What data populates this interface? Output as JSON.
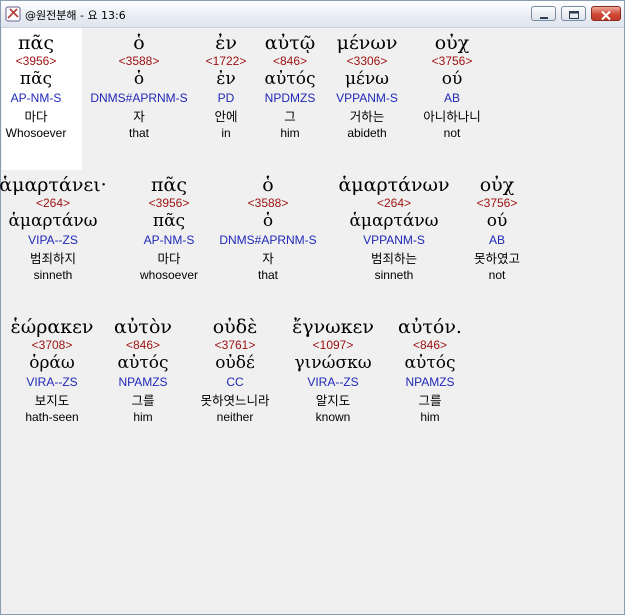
{
  "window": {
    "title": "@원전분해 - 요 13:6",
    "buttons": [
      "minimize",
      "maximize",
      "close"
    ],
    "close_color": "#c9402d"
  },
  "colors": {
    "strong": "#9c1010",
    "parse": "#1f28b8",
    "highlight": "#ffffff",
    "background": "#f0f0f0"
  },
  "rows": [
    {
      "words": [
        {
          "greek": "πᾶς",
          "strong": "<3956>",
          "lemma": "πᾶς",
          "parse": "AP-NM-S",
          "korean": "마다",
          "english": "Whosoever",
          "selected": true
        },
        {
          "greek": "ὁ",
          "strong": "<3588>",
          "lemma": "ὁ",
          "parse": "DNMS#APRNM-S",
          "korean": "자",
          "english": "that"
        },
        {
          "greek": "ἐν",
          "strong": "<1722>",
          "lemma": "ἐν",
          "parse": "PD",
          "korean": "안에",
          "english": "in"
        },
        {
          "greek": "αὐτῷ",
          "strong": "<846>",
          "lemma": "αὐτός",
          "parse": "NPDMZS",
          "korean": "그",
          "english": "him"
        },
        {
          "greek": "μένων",
          "strong": "<3306>",
          "lemma": "μένω",
          "parse": "VPPANM-S",
          "korean": "거하는",
          "english": "abideth"
        },
        {
          "greek": "οὐχ",
          "strong": "<3756>",
          "lemma": "ού",
          "parse": "AB",
          "korean": "아니하나니",
          "english": "not"
        }
      ]
    },
    {
      "words": [
        {
          "greek": "ἁμαρτάνει·",
          "strong": "<264>",
          "lemma": "ἁμαρτάνω",
          "parse": "VIPA--ZS",
          "korean": "범죄하지",
          "english": "sinneth"
        },
        {
          "greek": "πᾶς",
          "strong": "<3956>",
          "lemma": "πᾶς",
          "parse": "AP-NM-S",
          "korean": "마다",
          "english": "whosoever"
        },
        {
          "greek": "ὁ",
          "strong": "<3588>",
          "lemma": "ὁ",
          "parse": "DNMS#APRNM-S",
          "korean": "자",
          "english": "that"
        },
        {
          "greek": "ἁμαρτάνων",
          "strong": "<264>",
          "lemma": "ἁμαρτάνω",
          "parse": "VPPANM-S",
          "korean": "범죄하는",
          "english": "sinneth"
        },
        {
          "greek": "οὐχ",
          "strong": "<3756>",
          "lemma": "ού",
          "parse": "AB",
          "korean": "못하였고",
          "english": "not"
        }
      ]
    },
    {
      "words": [
        {
          "greek": "ἑώρακεν",
          "strong": "<3708>",
          "lemma": "ὁράω",
          "parse": "VIRA--ZS",
          "korean": "보지도",
          "english": "hath-seen"
        },
        {
          "greek": "αὐτὸν",
          "strong": "<846>",
          "lemma": "αὐτός",
          "parse": "NPAMZS",
          "korean": "그를",
          "english": "him"
        },
        {
          "greek": "οὐδὲ",
          "strong": "<3761>",
          "lemma": "οὐδέ",
          "parse": "CC",
          "korean": "못하엿느니라",
          "english": "neither"
        },
        {
          "greek": "ἔγνωκεν",
          "strong": "<1097>",
          "lemma": "γινώσκω",
          "parse": "VIRA--ZS",
          "korean": "알지도",
          "english": "known"
        },
        {
          "greek": "αὐτόν.",
          "strong": "<846>",
          "lemma": "αὐτός",
          "parse": "NPAMZS",
          "korean": "그를",
          "english": "him"
        }
      ]
    }
  ]
}
